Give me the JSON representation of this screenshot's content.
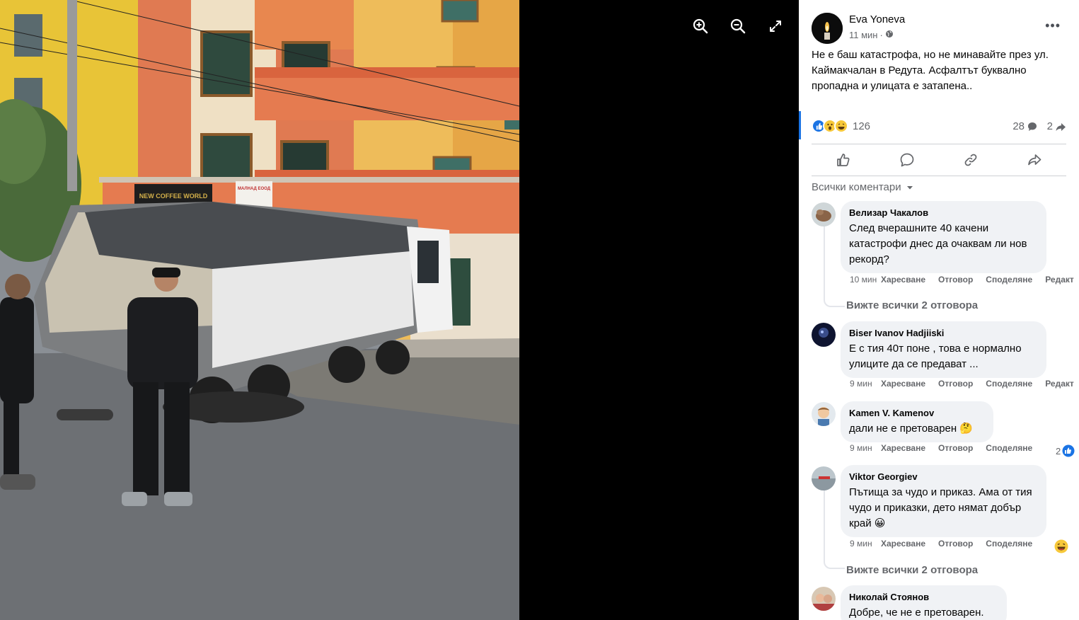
{
  "viewer": {
    "tools": [
      {
        "name": "zoom-in-icon"
      },
      {
        "name": "zoom-out-icon"
      },
      {
        "name": "fullscreen-icon"
      }
    ]
  },
  "post": {
    "author": "Eva Yoneva",
    "time": "11 мин",
    "audience_icon": "globe-icon",
    "text": "Не е баш катастрофа, но не минавайте през ул. Каймакчалан в Редута. Асфалтът буквално пропадна и улицата е затапена..",
    "reactions": [
      "like",
      "wow",
      "haha"
    ],
    "reaction_count": "126",
    "comment_count": "28",
    "share_count": "2",
    "actions": [
      "like-icon",
      "comment-icon",
      "link-icon",
      "share-icon"
    ]
  },
  "comments_filter": "Всички коментари",
  "comments": [
    {
      "name": "Велизар Чакалов",
      "text": "След вчерашните 40 качени катастрофи днес да очаквам ли нов рекорд?",
      "time": "10 мин",
      "like": "Харесване",
      "reply": "Отговор",
      "share": "Споделяне",
      "edit": "Редакт",
      "replies": "Вижте всички 2 отговора"
    },
    {
      "name": "Biser Ivanov Hadjiiski",
      "text": "Е с тия 40т поне , това е нормално улиците да се предават ...",
      "time": "9 мин",
      "like": "Харесване",
      "reply": "Отговор",
      "share": "Споделяне",
      "edit": "Редакт"
    },
    {
      "name": "Kamen V. Kamenov",
      "text": "дали не е претоварен 🤔",
      "time": "9 мин",
      "like": "Харесване",
      "reply": "Отговор",
      "share": "Споделяне",
      "reaction_count": "2"
    },
    {
      "name": "Viktor Georgiev",
      "text": "Пътища за чудо и приказ. Ама от тия чудо и приказки, дето нямат добър край 😀",
      "time": "9 мин",
      "like": "Харесване",
      "reply": "Отговор",
      "share": "Споделяне",
      "replies": "Вижте всички 2 отговора"
    },
    {
      "name": "Николай Стоянов",
      "text": "Добре, че не е претоварен."
    }
  ],
  "photo_signs": {
    "cafe": "NEW COFFEE WORLD",
    "shop": "МАЛНАД ЕООД"
  },
  "colors": {
    "accent": "#1b74e4",
    "text_secondary": "#65676b",
    "bubble": "#f0f2f5"
  }
}
